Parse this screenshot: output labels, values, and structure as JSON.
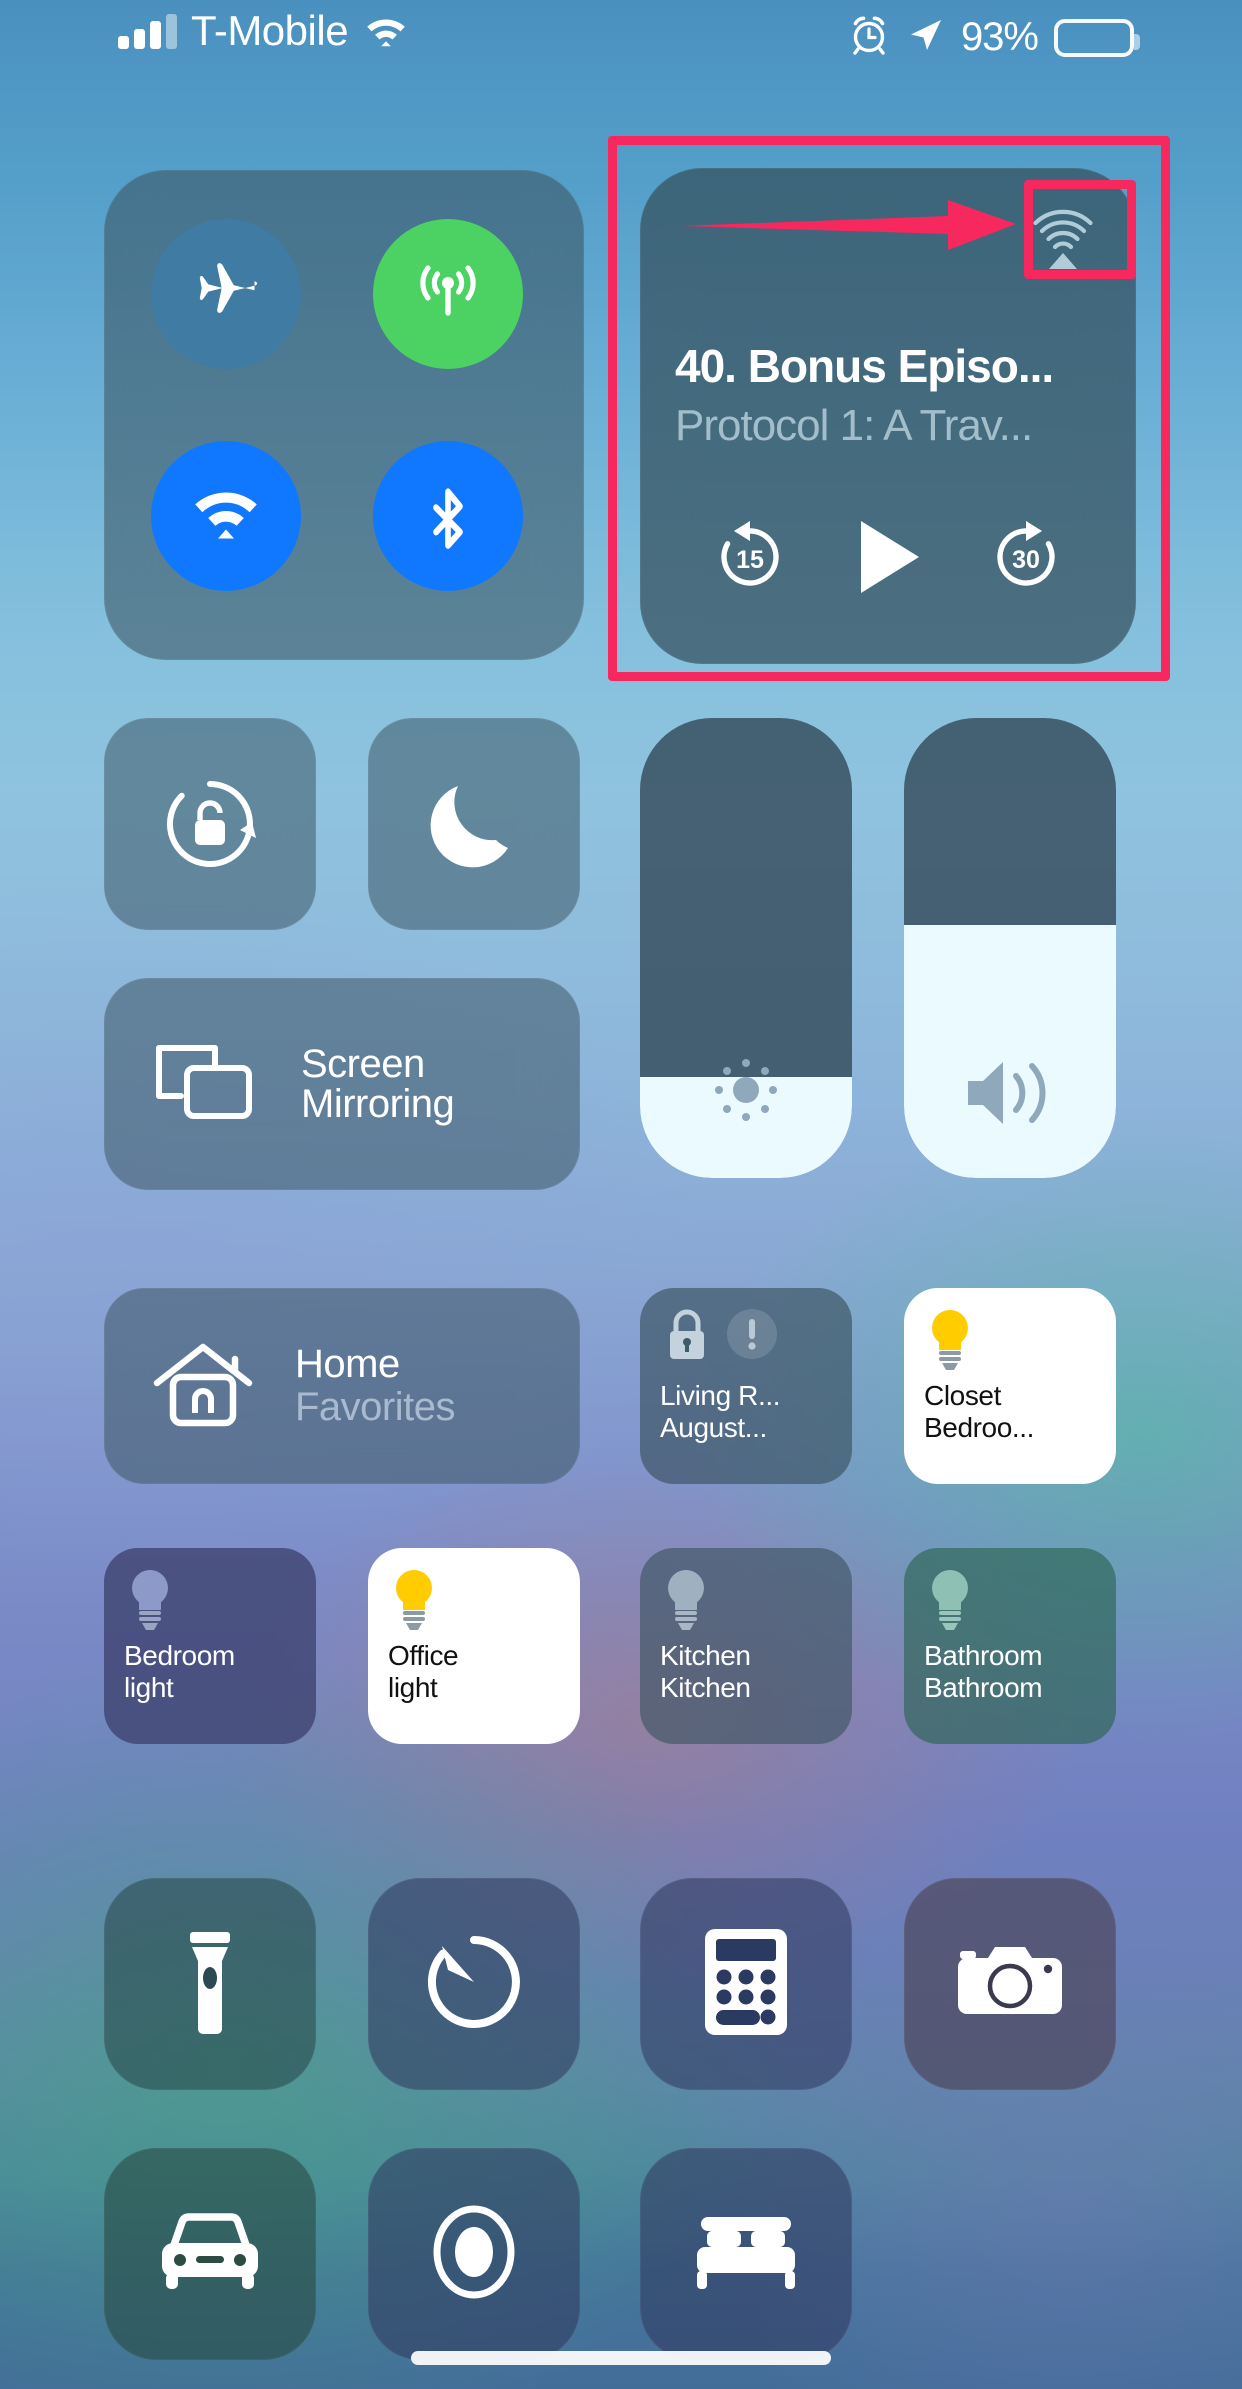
{
  "status_bar": {
    "signal_icon": "cellular-bars-icon",
    "carrier": "T-Mobile",
    "wifi_icon": "wifi-icon",
    "alarm_icon": "alarm-clock-icon",
    "location_icon": "location-arrow-icon",
    "battery_percent": "93%",
    "battery_icon": "battery-icon"
  },
  "connectivity": {
    "airplane": {
      "name": "Airplane Mode",
      "icon": "airplane-icon",
      "state": "off",
      "color": "#3f7ba3"
    },
    "cellular": {
      "name": "Cellular Data",
      "icon": "cellular-antenna-icon",
      "state": "on",
      "color": "#4cd263"
    },
    "wifi": {
      "name": "Wi-Fi",
      "icon": "wifi-icon",
      "state": "on",
      "color": "#1078ff"
    },
    "bluetooth": {
      "name": "Bluetooth",
      "icon": "bluetooth-icon",
      "state": "on",
      "color": "#1078ff"
    }
  },
  "media": {
    "title": "40. Bonus Episo...",
    "subtitle": "Protocol 1: A Trav...",
    "airplay_icon": "airplay-audio-icon",
    "skip_back_label": "15",
    "skip_forward_label": "30",
    "play_icon": "play-icon",
    "skip_back_icon": "skip-back-15-icon",
    "skip_forward_icon": "skip-forward-30-icon",
    "state": "paused"
  },
  "annotation": {
    "highlight_color": "#f6285e",
    "arrow_icon": "pointer-arrow-icon",
    "target": "airplay-button"
  },
  "toggles": {
    "rotation_lock": {
      "label": "Rotation Lock",
      "icon": "rotation-lock-icon",
      "state": "off"
    },
    "do_not_disturb": {
      "label": "Do Not Disturb",
      "icon": "crescent-moon-icon",
      "state": "off"
    },
    "screen_mirroring": {
      "line1": "Screen",
      "line2": "Mirroring",
      "icon": "screen-mirroring-icon"
    }
  },
  "sliders": {
    "brightness": {
      "label": "Brightness",
      "icon": "brightness-sun-icon",
      "percent": 22
    },
    "volume": {
      "label": "Volume",
      "icon": "speaker-waves-icon",
      "percent": 55
    }
  },
  "home": {
    "tile": {
      "line1": "Home",
      "line2": "Favorites",
      "icon": "house-icon"
    },
    "accessories": [
      {
        "line1": "Living R...",
        "line2": "August...",
        "icon": "padlock-icon",
        "badge_icon": "exclamation-badge-icon",
        "state": "off"
      },
      {
        "line1": "Closet",
        "line2": "Bedroo...",
        "icon": "lightbulb-icon",
        "state": "on"
      },
      {
        "line1": "Bedroom",
        "line2": "light",
        "icon": "lightbulb-icon",
        "state": "off"
      },
      {
        "line1": "Office",
        "line2": "light",
        "icon": "lightbulb-icon",
        "state": "on"
      },
      {
        "line1": "Kitchen",
        "line2": "Kitchen",
        "icon": "lightbulb-icon",
        "state": "off"
      },
      {
        "line1": "Bathroom",
        "line2": "Bathroom",
        "icon": "lightbulb-icon",
        "state": "off"
      }
    ],
    "bulb_on_color": "#ffcc00"
  },
  "utilities": [
    {
      "label": "Flashlight",
      "icon": "flashlight-icon"
    },
    {
      "label": "Timer",
      "icon": "timer-icon"
    },
    {
      "label": "Calculator",
      "icon": "calculator-icon"
    },
    {
      "label": "Camera",
      "icon": "camera-icon"
    },
    {
      "label": "Driving Focus",
      "icon": "car-icon"
    },
    {
      "label": "Screen Recording",
      "icon": "screen-record-icon"
    },
    {
      "label": "Sleep Mode",
      "icon": "bed-icon"
    }
  ],
  "home_indicator": {
    "name": "home-indicator"
  }
}
